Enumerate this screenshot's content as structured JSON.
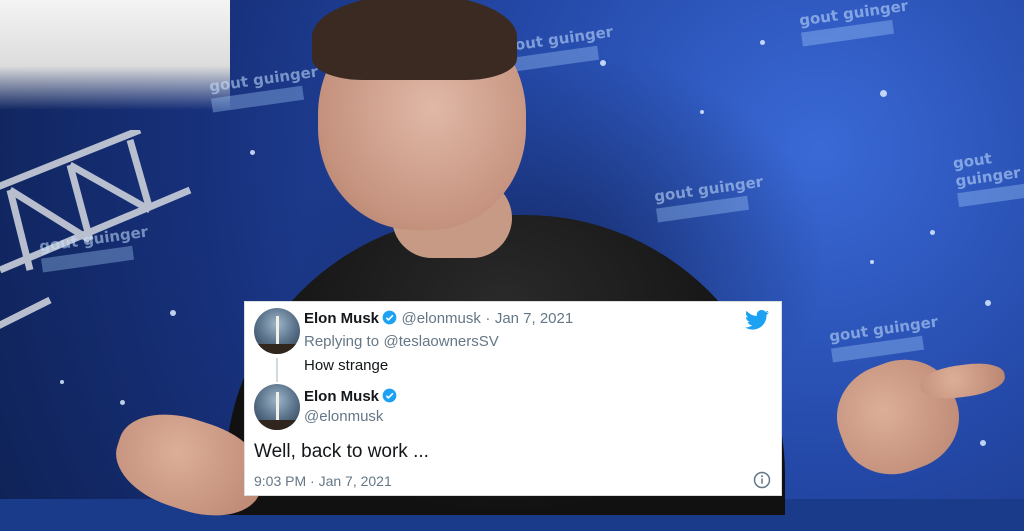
{
  "background": {
    "sponsor_text": "gout guinger"
  },
  "reply_tweet": {
    "author_name": "Elon Musk",
    "handle": "@elonmusk",
    "separator": "·",
    "date": "Jan 7, 2021",
    "replying_to_label": "Replying to",
    "replying_to_handle": "@teslaownersSV",
    "text": "How strange"
  },
  "main_tweet": {
    "author_name": "Elon Musk",
    "handle": "@elonmusk",
    "text": "Well, back to work ...",
    "timestamp": "9:03 PM · Jan 7, 2021"
  },
  "icons": {
    "brand": "twitter-bird-icon",
    "verified": "verified-badge-icon",
    "info": "info-icon"
  },
  "colors": {
    "twitter_blue": "#1da1f2",
    "text_primary": "#14171a",
    "text_muted": "#657786",
    "backdrop_blue": "#2449a8"
  }
}
